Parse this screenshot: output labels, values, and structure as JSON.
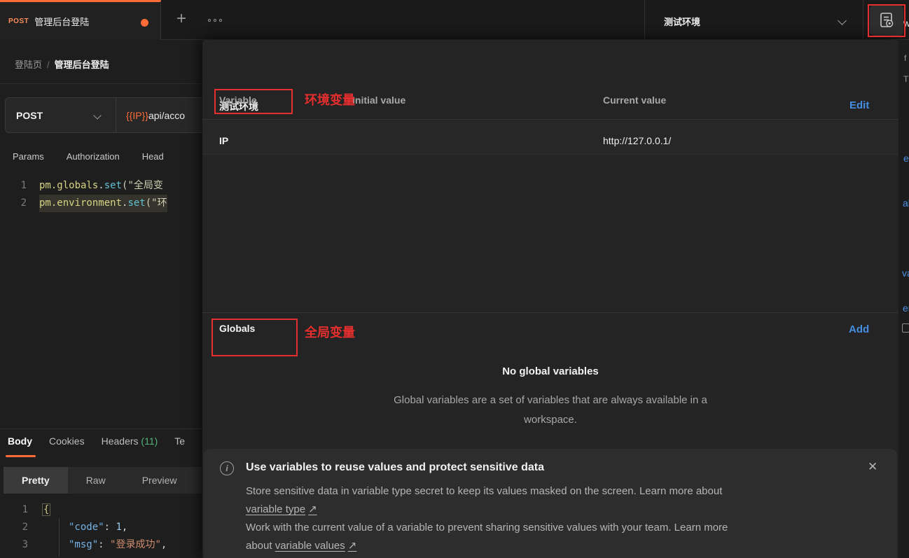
{
  "colors": {
    "accent_orange": "#ff6c37",
    "link_blue": "#468ee5",
    "annotation_red": "#e62e2e",
    "headers_count_green": "#54b47a"
  },
  "topbar": {
    "tab": {
      "method": "POST",
      "title": "管理后台登陆"
    },
    "environment_selector": {
      "value": "测试环境"
    }
  },
  "icons": {
    "plus": "+",
    "close": "✕",
    "info_letter": "i",
    "external_arrow": "↗"
  },
  "request_pane": {
    "breadcrumb": {
      "parent": "登陆页",
      "separator": "/",
      "current": "管理后台登陆"
    },
    "method": "POST",
    "url": {
      "variable": "{{IP}}",
      "path": "api/acco"
    },
    "tabs": [
      "Params",
      "Authorization",
      "Head"
    ],
    "script": {
      "lines": [
        {
          "number": "1",
          "object": "pm.globals",
          "dot": ".",
          "method": "set",
          "tail": "(\"全局变"
        },
        {
          "number": "2",
          "object": "pm.environment",
          "dot": ".",
          "method": "set",
          "tail": "(\"环"
        }
      ]
    }
  },
  "response_pane": {
    "tabs": {
      "body": "Body",
      "cookies": "Cookies",
      "headers": "Headers",
      "headers_count": "(11)",
      "partial": "Te"
    },
    "view_modes": [
      "Pretty",
      "Raw",
      "Preview"
    ],
    "json_lines": [
      {
        "number": "1",
        "brace": "{"
      },
      {
        "number": "2",
        "key": "\"code\"",
        "colon": ": ",
        "value": "1",
        "comma": ","
      },
      {
        "number": "3",
        "key": "\"msg\"",
        "colon": ": ",
        "value": "\"登录成功\"",
        "comma": ","
      }
    ]
  },
  "env_panel": {
    "title": "测试环境",
    "edit_link": "Edit",
    "columns": {
      "variable": "Variable",
      "initial": "Initial value",
      "current": "Current value"
    },
    "annotations": {
      "environment": "环境变量",
      "globals": "全局变量"
    },
    "rows": [
      {
        "variable": "IP",
        "current": "http://127.0.0.1/"
      }
    ],
    "globals": {
      "title": "Globals",
      "add_link": "Add",
      "empty_title": "No global variables",
      "empty_line1": "Global variables are a set of variables that are always available in a",
      "empty_line2": "workspace."
    },
    "banner": {
      "title": "Use variables to reuse values and protect sensitive data",
      "line1": "Store sensitive data in variable type secret to keep its values masked on the screen. Learn more about",
      "line2_link": "variable type",
      "line3": "Work with the current value of a variable to prevent sharing sensitive values with your team. Learn more",
      "line4_pre": "about ",
      "line4_link": "variable values"
    }
  },
  "edge_fragments": {
    "f0": "w",
    "f1": "f",
    "f2": "T",
    "f3": "e",
    "f4": "al",
    "f5": "va",
    "f6": "er"
  }
}
